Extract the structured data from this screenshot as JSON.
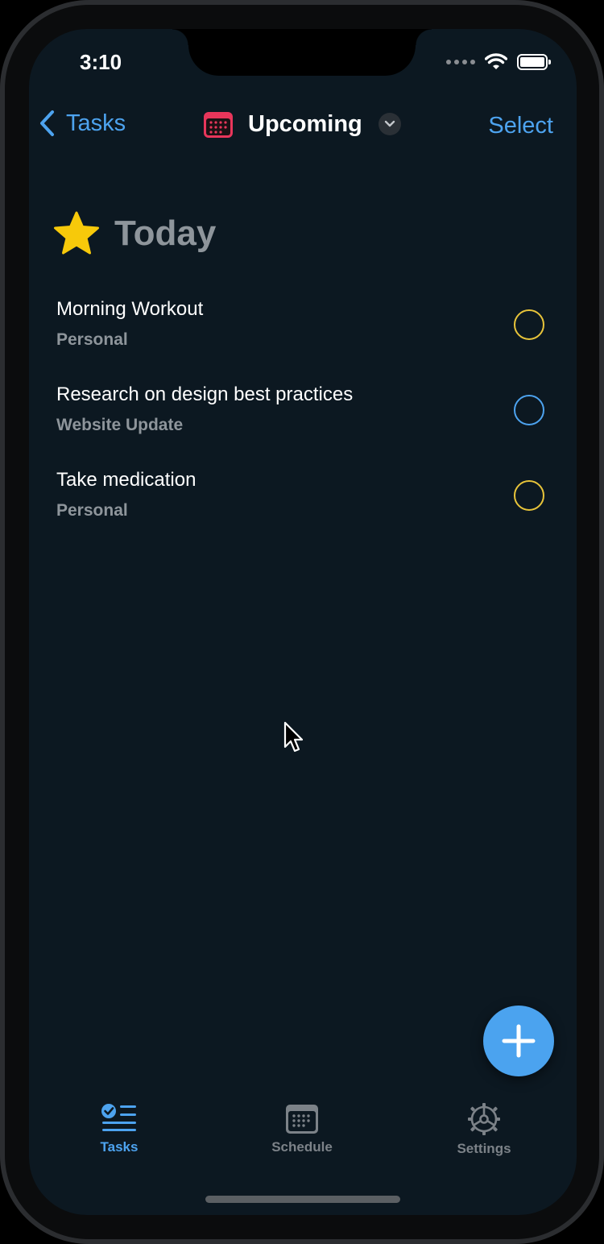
{
  "status_bar": {
    "time": "3:10"
  },
  "nav": {
    "back_label": "Tasks",
    "title": "Upcoming",
    "select_label": "Select"
  },
  "section": {
    "title": "Today",
    "icon": "star-icon"
  },
  "tasks": [
    {
      "title": "Morning Workout",
      "subtitle": "Personal",
      "circle_color": "#e8c43a"
    },
    {
      "title": "Research on design best practices",
      "subtitle": "Website Update",
      "circle_color": "#4da3ef"
    },
    {
      "title": "Take medication",
      "subtitle": "Personal",
      "circle_color": "#e8c43a"
    }
  ],
  "tabbar": {
    "tabs": [
      {
        "label": "Tasks",
        "icon": "tasks-checklist-icon",
        "active": true
      },
      {
        "label": "Schedule",
        "icon": "calendar-icon",
        "active": false
      },
      {
        "label": "Settings",
        "icon": "gear-icon",
        "active": false
      }
    ]
  },
  "colors": {
    "accent": "#4da3ef",
    "background": "#0c1821",
    "calendar_icon": "#e8365b",
    "star": "#f7c90a",
    "secondary_text": "#8e959b"
  }
}
